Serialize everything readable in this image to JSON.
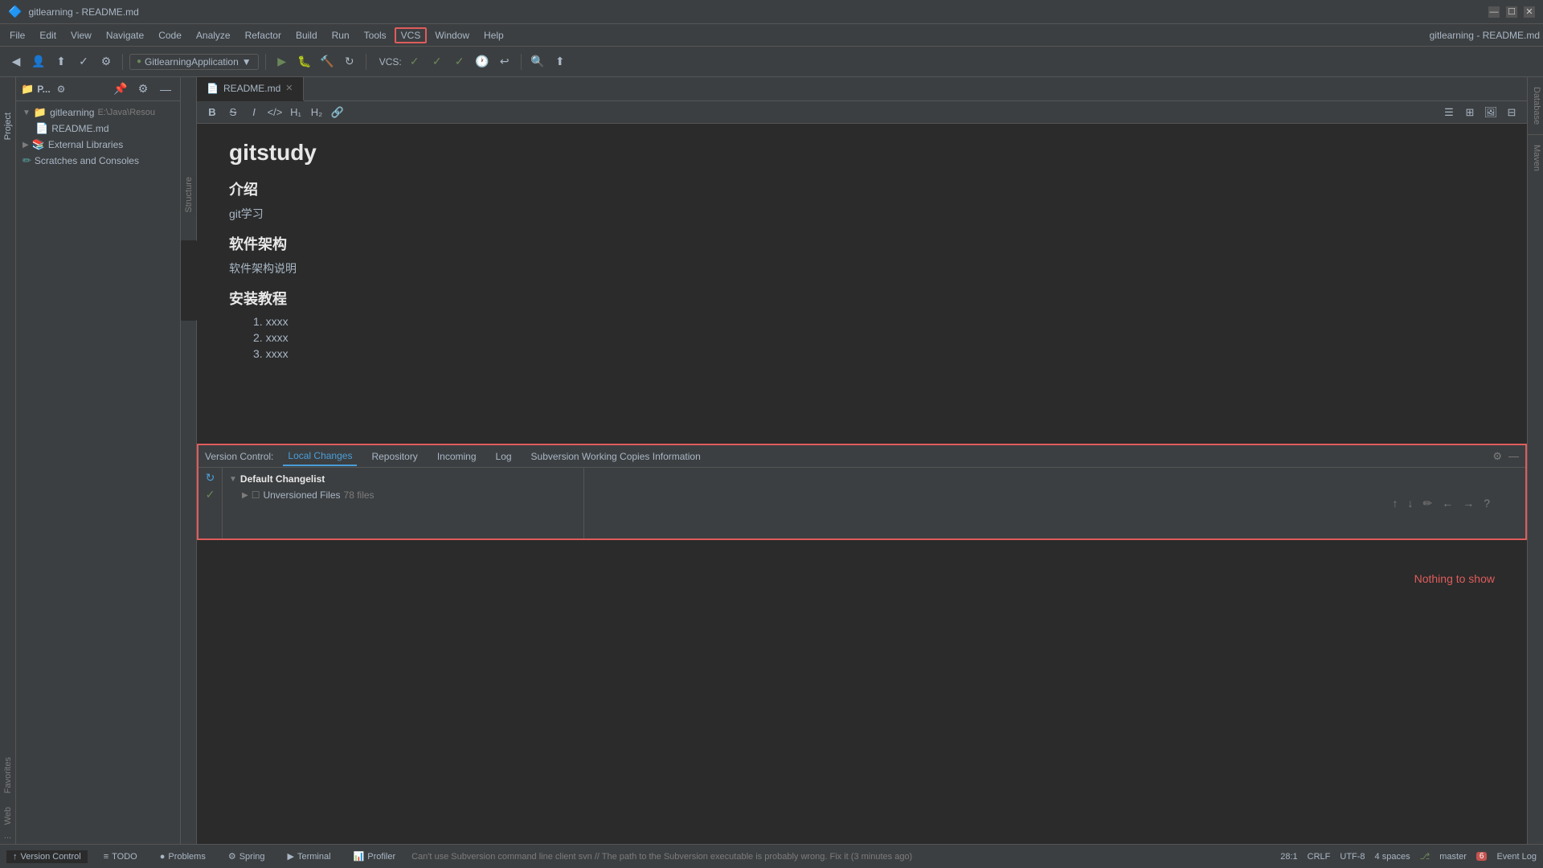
{
  "app": {
    "title": "gitlearning - README.md"
  },
  "titleBar": {
    "title": "gitlearning - README.md",
    "minimize": "—",
    "maximize": "☐",
    "close": "✕"
  },
  "menuBar": {
    "items": [
      "File",
      "Edit",
      "View",
      "Navigate",
      "Code",
      "Analyze",
      "Refactor",
      "Build",
      "Run",
      "Tools",
      "VCS",
      "Window",
      "Help"
    ],
    "highlighted": "VCS",
    "appName": "GitlearningApplication",
    "vcsLabel": "VCS:"
  },
  "projectPanel": {
    "title": "gitlearning",
    "path": "E:\\Java\\Resou...",
    "items": [
      {
        "label": "gitlearning",
        "sublabel": "E:\\Java\\Resou",
        "type": "project",
        "expanded": true
      },
      {
        "label": "External Libraries",
        "type": "folder"
      },
      {
        "label": "Scratches and Consoles",
        "type": "scratches"
      }
    ]
  },
  "fileTab": {
    "name": "README.md",
    "modified": false
  },
  "editor": {
    "content": {
      "title": "gitstudy",
      "sections": [
        {
          "heading": "介绍",
          "level": 2
        },
        {
          "text": "git学习",
          "level": 0
        },
        {
          "heading": "软件架构",
          "level": 2
        },
        {
          "text": "软件架构说明",
          "level": 0
        },
        {
          "heading": "安装教程",
          "level": 2
        },
        {
          "list": [
            "xxxx",
            "xxxx",
            "xxxx"
          ]
        }
      ]
    }
  },
  "versionControl": {
    "label": "Version Control:",
    "tabs": [
      "Local Changes",
      "Repository",
      "Incoming",
      "Log",
      "Subversion Working Copies Information"
    ],
    "activeTab": "Local Changes",
    "tree": {
      "items": [
        {
          "label": "Default Changelist",
          "bold": true,
          "level": 0
        },
        {
          "label": "Unversioned Files",
          "count": "78 files",
          "level": 1
        }
      ]
    },
    "nothingToShow": "Nothing to show"
  },
  "statusBar": {
    "tabs": [
      {
        "label": "Version Control",
        "icon": "↑",
        "active": true
      },
      {
        "label": "TODO",
        "icon": "≡"
      },
      {
        "label": "Problems",
        "icon": "●"
      },
      {
        "label": "Spring",
        "icon": "⚙"
      },
      {
        "label": "Terminal",
        "icon": "▶"
      },
      {
        "label": "Profiler",
        "icon": "📊"
      }
    ],
    "message": "Can't use Subversion command line client svn // The path to the Subversion executable is probably wrong. Fix it (3 minutes ago)",
    "position": "28:1",
    "lineEnding": "CRLF",
    "encoding": "UTF-8",
    "indent": "4 spaces",
    "branch": "master",
    "eventLog": "Event Log",
    "errorCount": "6"
  },
  "rightStrip": {
    "tabs": [
      "Database",
      "Maven"
    ]
  },
  "leftStrip": {
    "tabs": [
      "Project",
      "Structure",
      "Favorites",
      "Web"
    ]
  }
}
